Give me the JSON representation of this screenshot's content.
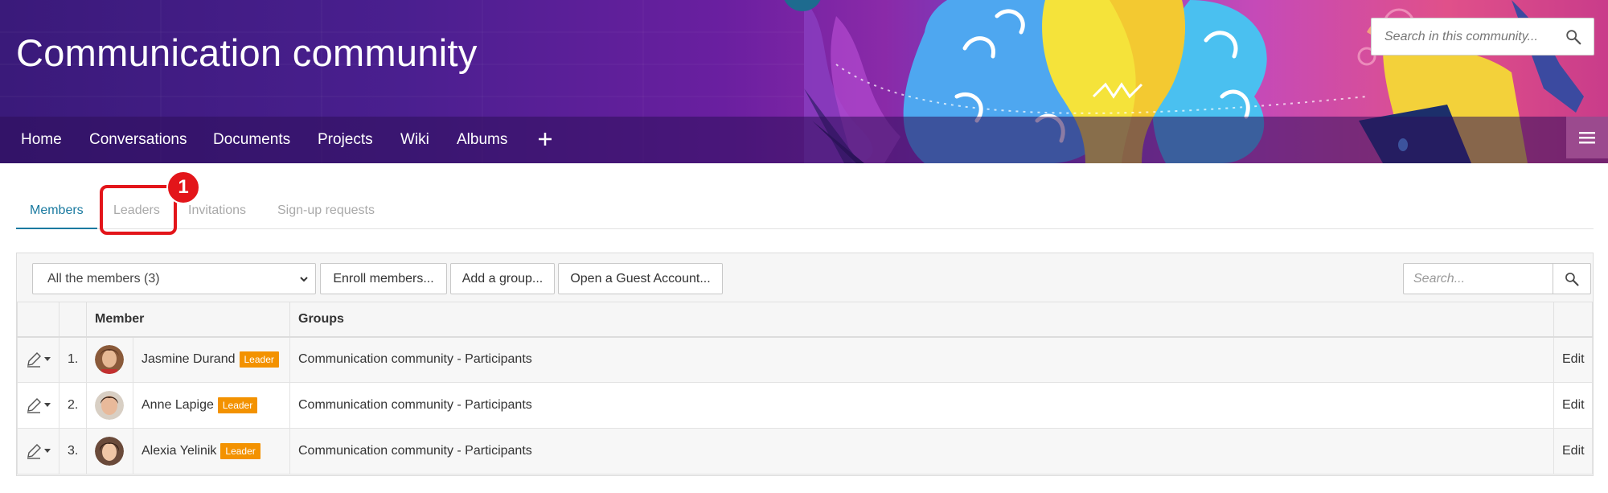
{
  "header": {
    "title": "Communication community",
    "search_placeholder": "Search in this community..."
  },
  "nav": {
    "items": [
      {
        "label": "Home"
      },
      {
        "label": "Conversations"
      },
      {
        "label": "Documents"
      },
      {
        "label": "Projects"
      },
      {
        "label": "Wiki"
      },
      {
        "label": "Albums"
      }
    ],
    "add_icon": "plus-icon",
    "menu_icon": "hamburger-icon"
  },
  "tabs": [
    {
      "label": "Members",
      "active": true
    },
    {
      "label": "Leaders",
      "active": false
    },
    {
      "label": "Invitations",
      "active": false
    },
    {
      "label": "Sign-up requests",
      "active": false
    }
  ],
  "annotation": {
    "step_number": "1",
    "color": "#e3151a"
  },
  "toolbar": {
    "filter_selected": "All the members (3)",
    "enroll_label": "Enroll members...",
    "add_group_label": "Add a group...",
    "guest_label": "Open a Guest Account...",
    "search_placeholder": "Search..."
  },
  "table": {
    "headers": [
      "",
      "",
      "Member",
      "Groups",
      ""
    ],
    "rows": [
      {
        "num": "1.",
        "name": "Jasmine Durand",
        "badge": "Leader",
        "group": "Communication community - Participants",
        "edit": "Edit"
      },
      {
        "num": "2.",
        "name": "Anne Lapige",
        "badge": "Leader",
        "group": "Communication community - Participants",
        "edit": "Edit"
      },
      {
        "num": "3.",
        "name": "Alexia Yelinik",
        "badge": "Leader",
        "group": "Communication community - Participants",
        "edit": "Edit"
      }
    ]
  },
  "colors": {
    "accent": "#1a7aa0",
    "badge": "#f39200",
    "inactive_tab": "#a9a9a9"
  }
}
